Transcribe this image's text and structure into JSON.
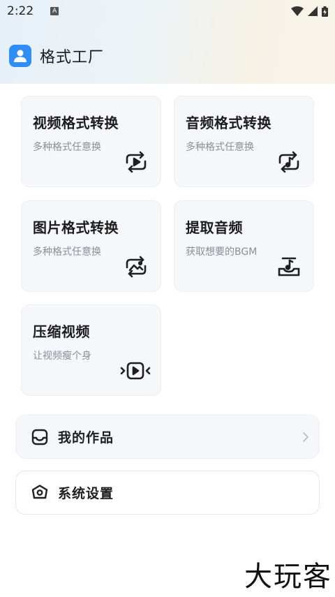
{
  "status_bar": {
    "time": "2:22",
    "notification_letter": "A"
  },
  "app": {
    "title": "格式工厂"
  },
  "cards": [
    {
      "title": "视频格式转换",
      "subtitle": "多种格式任意换",
      "icon": "video-convert-icon"
    },
    {
      "title": "音频格式转换",
      "subtitle": "多种格式任意换",
      "icon": "audio-convert-icon"
    },
    {
      "title": "图片格式转换",
      "subtitle": "多种格式任意换",
      "icon": "image-convert-icon"
    },
    {
      "title": "提取音频",
      "subtitle": "获取想要的BGM",
      "icon": "extract-audio-icon"
    },
    {
      "title": "压缩视频",
      "subtitle": "让视频瘦个身",
      "icon": "compress-video-icon"
    }
  ],
  "rows": {
    "works": {
      "label": "我的作品",
      "icon": "box-icon"
    },
    "settings": {
      "label": "系统设置",
      "icon": "hexagon-settings-icon"
    }
  },
  "watermark": "大玩客",
  "colors": {
    "brand": "#2f8df6",
    "card_bg": "#f5f7fa",
    "muted_text": "#8a8f96"
  }
}
